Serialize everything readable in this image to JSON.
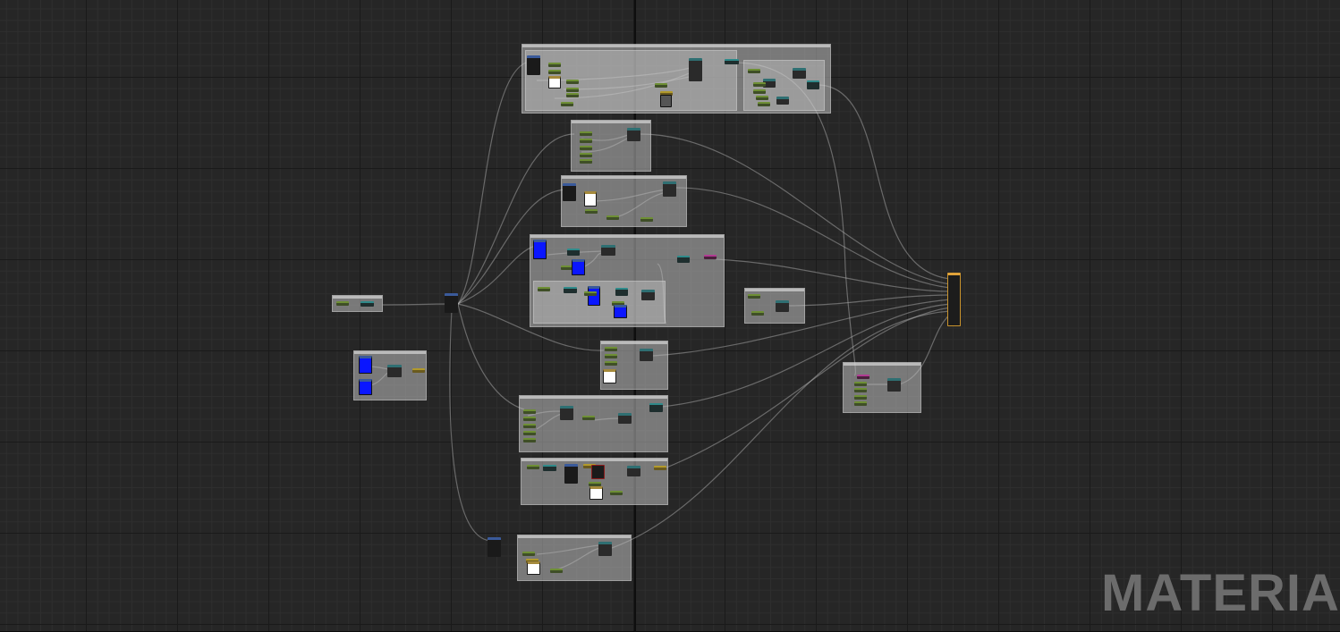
{
  "editor": {
    "watermark_label": "MATERIAL"
  },
  "colors": {
    "canvas_bg": "#262626",
    "comment_box": "#bebebe",
    "parameter_header": "#6e8f35",
    "function_header": "#2f6f72",
    "texture_header": "#3a5a9a",
    "blue_preview": "#0a16ff",
    "result_node_border": "#c9932c",
    "wire": "#bcbcbc"
  },
  "icons": {
    "node_pin": "pin-icon"
  }
}
